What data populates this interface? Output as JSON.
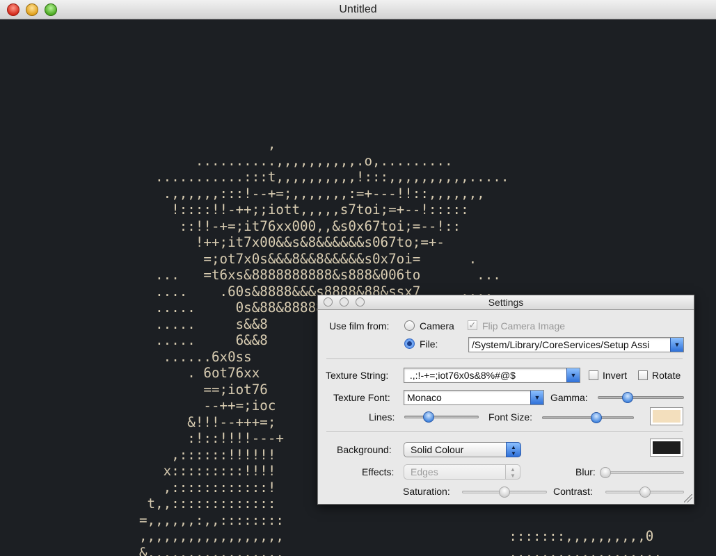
{
  "window": {
    "title": "Untitled"
  },
  "ascii_lines": [
    "                ,",
    "       ..........,,,,,,,,,,.o,.........",
    "  ...........:::t,,,,,,,,,,!:::,,,,,,,,,,.....",
    "   .,,,,,,:::!--+=;,,,,,,,:=+---!!::,,,,,,,",
    "    !::::!!-++;;iott,,,,,s7toi;=+--!:::::",
    "     ::!!-+=;it76xx000,,&s0x67toi;=--!::",
    "       !++;it7x00&&s&8&&&&&&s067to;=+-",
    "        =;ot7x0s&&&8&&8&&&&&s0x7oi=      .",
    "  ...   =t6xs&8888888888&s888&006to       ...",
    "  ....    .60s&8888&&&s8888&88&ssx7     ....",
    "  .....     0s&88&8888888888&&ss,      .....",
    "  .....     s&&8",
    "  .....     6&&8",
    "   ......6x0ss",
    "      . 6ot76xx",
    "        ==;iot76",
    "        --++=;ioc",
    "      &!!!--+++=;",
    "      :!::!!!!---+",
    "    ,::::::!!!!!!",
    "   x:::::::::!!!!",
    "   ,::::::::::::!",
    " t,,:::::::::::::",
    "=,,,,,,:,,::::::::",
    ",,,,,,,,,,,,,,,,,,                            :::::::,,,,,,,,,,0",
    "&.....,,,,,,,,,,,.                            ,,,,,,,,,,,,,,,,,,,"
  ],
  "settings": {
    "title": "Settings",
    "use_film_from_label": "Use film from:",
    "camera_label": "Camera",
    "camera_selected": false,
    "flip_camera_label": "Flip Camera Image",
    "flip_camera_checked": true,
    "file_label": "File:",
    "file_selected": true,
    "file_path": "/System/Library/CoreServices/Setup Assi",
    "texture_string_label": "Texture String:",
    "texture_string_value": " .,:!-+=;iot76x0s&8%#@$",
    "invert_label": "Invert",
    "invert_checked": false,
    "rotate_label": "Rotate",
    "rotate_checked": false,
    "texture_font_label": "Texture Font:",
    "texture_font_value": "Monaco",
    "gamma_label": "Gamma:",
    "gamma_level": 0.35,
    "lines_label": "Lines:",
    "lines_level": 0.33,
    "font_size_label": "Font Size:",
    "font_size_level": 0.59,
    "text_color": "#f3dfbd",
    "background_label": "Background:",
    "background_value": "Solid Colour",
    "background_color": "#1e1e1e",
    "effects_label": "Effects:",
    "effects_value": "Edges",
    "blur_label": "Blur:",
    "blur_level": 0.0,
    "saturation_label": "Saturation:",
    "saturation_level": 0.5,
    "contrast_label": "Contrast:",
    "contrast_level": 0.5
  },
  "colors": {
    "canvas_bg": "#1c1f23",
    "ascii_fg": "#d8ccb1",
    "accent": "#3f82dd"
  }
}
